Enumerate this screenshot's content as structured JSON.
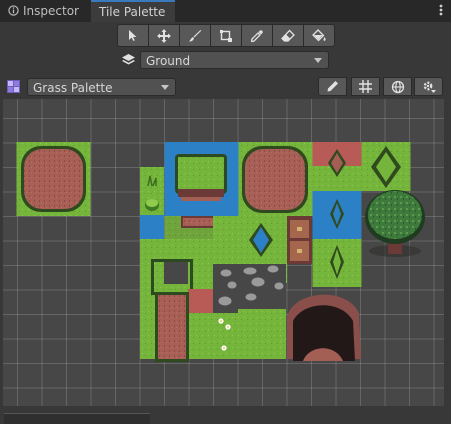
{
  "tabs": [
    {
      "label": "Inspector",
      "icon": "info-icon",
      "active": false
    },
    {
      "label": "Tile Palette",
      "icon": "",
      "active": true
    }
  ],
  "tools": [
    {
      "name": "select-tool",
      "icon": "arrow-icon"
    },
    {
      "name": "move-tool",
      "icon": "move-icon"
    },
    {
      "name": "paint-tool",
      "icon": "brush-icon"
    },
    {
      "name": "box-fill-tool",
      "icon": "box-icon"
    },
    {
      "name": "picker-tool",
      "icon": "eyedropper-icon"
    },
    {
      "name": "erase-tool",
      "icon": "eraser-icon"
    },
    {
      "name": "fill-tool",
      "icon": "bucket-icon"
    }
  ],
  "layer": {
    "selected": "Ground",
    "icon": "layers-icon"
  },
  "palette": {
    "selected": "Grass Palette",
    "icon": "palette-icon"
  },
  "palette_tools": [
    {
      "name": "edit-palette",
      "icon": "pencil-icon"
    },
    {
      "name": "toggle-grid",
      "icon": "grid-icon"
    },
    {
      "name": "gizmos",
      "icon": "globe-icon"
    },
    {
      "name": "brush-settings",
      "icon": "settings-icon"
    }
  ],
  "colors": {
    "grass": "#76b53b",
    "grass_dark": "#3f7a22",
    "dirt": "#a45f55",
    "dirt_dark": "#6b3a36",
    "water": "#2c80c6",
    "red_tile": "#b85a55",
    "accent_tab": "#3a79bb"
  }
}
